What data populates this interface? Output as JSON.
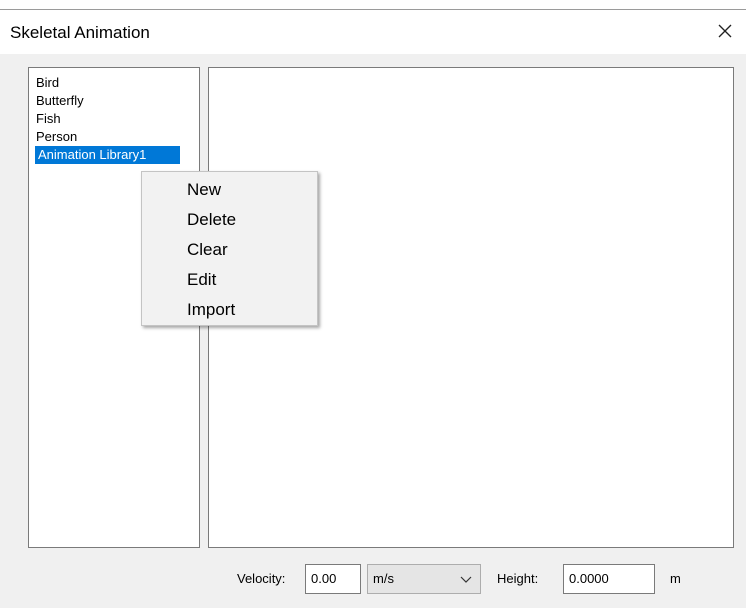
{
  "window": {
    "title": "Skeletal Animation",
    "close_icon": "close-icon"
  },
  "library_list": {
    "items": [
      {
        "label": "Bird",
        "selected": false
      },
      {
        "label": "Butterfly",
        "selected": false
      },
      {
        "label": "Fish",
        "selected": false
      },
      {
        "label": "Person",
        "selected": false
      },
      {
        "label": "Animation Library1",
        "selected": true
      }
    ],
    "selection_color": "#0078d7"
  },
  "context_menu": {
    "items": [
      "New",
      "Delete",
      "Clear",
      "Edit",
      "Import"
    ]
  },
  "controls": {
    "velocity_label": "Velocity:",
    "velocity_value": "0.00",
    "unit_selected": "m/s",
    "height_label": "Height:",
    "height_value": "0.0000",
    "height_unit": "m"
  }
}
